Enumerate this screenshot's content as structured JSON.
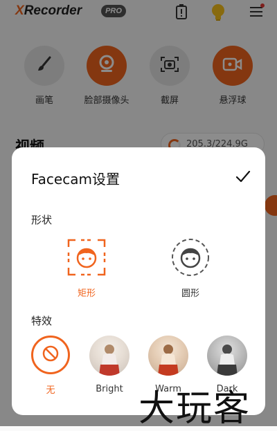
{
  "app": {
    "logo_x": "X",
    "logo_rest": "Recorder",
    "pro_badge": "PRO",
    "accent": "#f0641e"
  },
  "header_icons": [
    "battery-icon",
    "lightbulb-icon",
    "menu-icon"
  ],
  "tools": [
    {
      "label": "画笔",
      "icon": "brush-icon",
      "active": false
    },
    {
      "label": "脸部摄像头",
      "icon": "webcam-icon",
      "active": true
    },
    {
      "label": "截屏",
      "icon": "camera-icon",
      "active": false
    },
    {
      "label": "悬浮球",
      "icon": "video-camera-icon",
      "active": true
    }
  ],
  "videos": {
    "title": "视频",
    "storage": "205.3/224.9G"
  },
  "sheet": {
    "title": "Facecam设置",
    "shape_label": "形状",
    "shapes": [
      {
        "label": "矩形",
        "selected": true
      },
      {
        "label": "圆形",
        "selected": false
      }
    ],
    "effects_label": "特效",
    "effects": [
      {
        "label": "无",
        "selected": true
      },
      {
        "label": "Bright",
        "selected": false
      },
      {
        "label": "Warm",
        "selected": false
      },
      {
        "label": "Dark",
        "selected": false
      }
    ]
  },
  "watermark": "大玩客"
}
